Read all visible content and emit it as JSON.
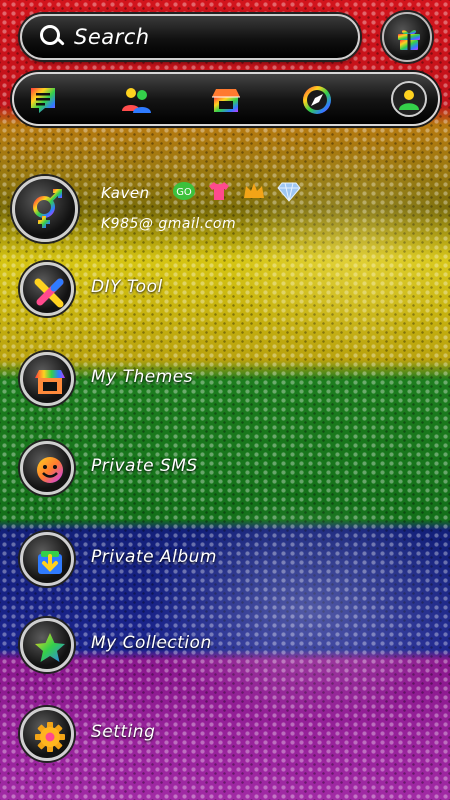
{
  "search": {
    "label": "Search"
  },
  "toolbar": {
    "icons": [
      "message-list-icon",
      "contacts-icon",
      "store-icon",
      "compass-icon",
      "avatar-icon"
    ]
  },
  "profile": {
    "name": "Kaven",
    "email": "K985@ gmail.com",
    "badges": [
      "go-badge-icon",
      "tshirt-icon",
      "crown-icon",
      "diamond-icon"
    ]
  },
  "menu": [
    {
      "label": "DIY Tool",
      "icon": "diy-tool-icon"
    },
    {
      "label": "My Themes",
      "icon": "themes-store-icon"
    },
    {
      "label": "Private SMS",
      "icon": "private-sms-icon"
    },
    {
      "label": "Private Album",
      "icon": "private-album-icon"
    },
    {
      "label": "My Collection",
      "icon": "star-icon"
    },
    {
      "label": "Setting",
      "icon": "gear-icon"
    }
  ]
}
